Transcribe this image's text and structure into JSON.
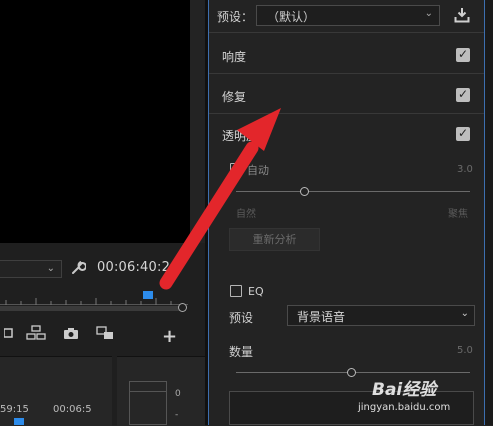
{
  "program_monitor": {
    "timecode_dropdown": "",
    "timecode": "00:06:40:2",
    "timeline_times": [
      "59:15",
      "00:06:5"
    ],
    "meter_scale": [
      "0",
      "-"
    ]
  },
  "essential_sound": {
    "preset_label": "预设：",
    "preset_value": "（默认）",
    "sections": [
      {
        "label": "响度",
        "checked": true
      },
      {
        "label": "修复",
        "checked": true
      },
      {
        "label": "透明度",
        "checked": true
      }
    ],
    "auto_label": "自动",
    "auto_value": "3.0",
    "range_min": "自然",
    "range_max": "聚焦",
    "reanalyze_button": "重新分析",
    "eq_label": "EQ",
    "eq_preset_label": "预设",
    "eq_preset_value": "背景语音",
    "amount_label": "数量",
    "amount_value": "5.0"
  },
  "watermark": {
    "brand": "Bai经验",
    "url": "jingyan.baidu.com"
  },
  "colors": {
    "accent_blue": "#2d8ceb",
    "arrow_red": "#e3262b",
    "panel_bg": "#232323"
  },
  "icons": [
    "wrench-icon",
    "download-preset-icon",
    "checkbox-checked-icon",
    "add-icon",
    "camera-icon"
  ]
}
